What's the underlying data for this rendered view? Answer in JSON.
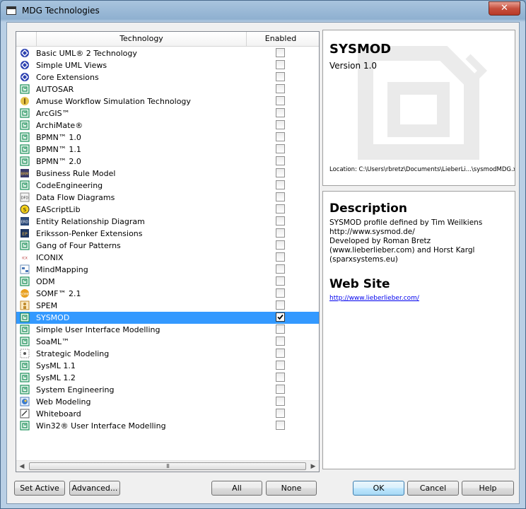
{
  "window": {
    "title": "MDG Technologies",
    "close_glyph": "✕"
  },
  "list": {
    "columns": {
      "technology": "Technology",
      "enabled": "Enabled"
    },
    "rows": [
      {
        "name": "Basic UML® 2 Technology",
        "icon": "uml-icon",
        "enabled": false
      },
      {
        "name": "Simple UML Views",
        "icon": "uml-icon",
        "enabled": false
      },
      {
        "name": "Core Extensions",
        "icon": "uml-icon",
        "enabled": false
      },
      {
        "name": "AUTOSAR",
        "icon": "mdg-icon",
        "enabled": false
      },
      {
        "name": "Amuse Workflow Simulation Technology",
        "icon": "amuse-icon",
        "enabled": false
      },
      {
        "name": "ArcGIS™",
        "icon": "mdg-icon",
        "enabled": false
      },
      {
        "name": "ArchiMate®",
        "icon": "mdg-icon",
        "enabled": false
      },
      {
        "name": "BPMN™ 1.0",
        "icon": "mdg-icon",
        "enabled": false
      },
      {
        "name": "BPMN™ 1.1",
        "icon": "mdg-icon",
        "enabled": false
      },
      {
        "name": "BPMN™ 2.0",
        "icon": "mdg-icon",
        "enabled": false
      },
      {
        "name": "Business Rule Model",
        "icon": "brm-icon",
        "enabled": false
      },
      {
        "name": "CodeEngineering",
        "icon": "mdg-icon",
        "enabled": false
      },
      {
        "name": "Data Flow Diagrams",
        "icon": "dfd-icon",
        "enabled": false
      },
      {
        "name": "EAScriptLib",
        "icon": "script-icon",
        "enabled": false
      },
      {
        "name": "Entity Relationship Diagram",
        "icon": "erd-icon",
        "enabled": false
      },
      {
        "name": "Eriksson-Penker Extensions",
        "icon": "ep-icon",
        "enabled": false
      },
      {
        "name": "Gang of Four Patterns",
        "icon": "mdg-icon",
        "enabled": false
      },
      {
        "name": "ICONIX",
        "icon": "iconix-icon",
        "enabled": false
      },
      {
        "name": "MindMapping",
        "icon": "mindmap-icon",
        "enabled": false
      },
      {
        "name": "ODM",
        "icon": "mdg-icon",
        "enabled": false
      },
      {
        "name": "SOMF™ 2.1",
        "icon": "somf-icon",
        "enabled": false
      },
      {
        "name": "SPEM",
        "icon": "spem-icon",
        "enabled": false
      },
      {
        "name": "SYSMOD",
        "icon": "mdg-icon",
        "enabled": true,
        "selected": true
      },
      {
        "name": "Simple User Interface Modelling",
        "icon": "mdg-icon",
        "enabled": false
      },
      {
        "name": "SoaML™",
        "icon": "mdg-icon",
        "enabled": false
      },
      {
        "name": "Strategic Modeling",
        "icon": "strategic-icon",
        "enabled": false
      },
      {
        "name": "SysML 1.1",
        "icon": "mdg-icon",
        "enabled": false
      },
      {
        "name": "SysML 1.2",
        "icon": "mdg-icon",
        "enabled": false
      },
      {
        "name": "System Engineering",
        "icon": "mdg-icon",
        "enabled": false
      },
      {
        "name": "Web Modeling",
        "icon": "web-icon",
        "enabled": false
      },
      {
        "name": "Whiteboard",
        "icon": "whiteboard-icon",
        "enabled": false
      },
      {
        "name": "Win32® User Interface Modelling",
        "icon": "mdg-icon",
        "enabled": false
      }
    ]
  },
  "details": {
    "name": "SYSMOD",
    "version": "Version 1.0",
    "location": "Location: C:\\Users\\rbretz\\Documents\\LieberLi...\\sysmodMDG.xml",
    "description_heading": "Description",
    "description_lines": [
      "SYSMOD profile defined by Tim Weilkiens",
      "http://www.sysmod.de/",
      "Developed by Roman Bretz",
      "(www.lieberlieber.com) and Horst Kargl",
      "(sparxsystems.eu)"
    ],
    "website_heading": "Web Site",
    "website_url": "http://www.lieberlieber.com/"
  },
  "buttons": {
    "set_active": "Set Active",
    "advanced": "Advanced...",
    "all": "All",
    "none": "None",
    "ok": "OK",
    "cancel": "Cancel",
    "help": "Help"
  },
  "colors": {
    "selection": "#3399ff",
    "link": "#0000ee",
    "mdg_icon": "#1b8f5a",
    "uml_icon": "#2a3fb0"
  }
}
